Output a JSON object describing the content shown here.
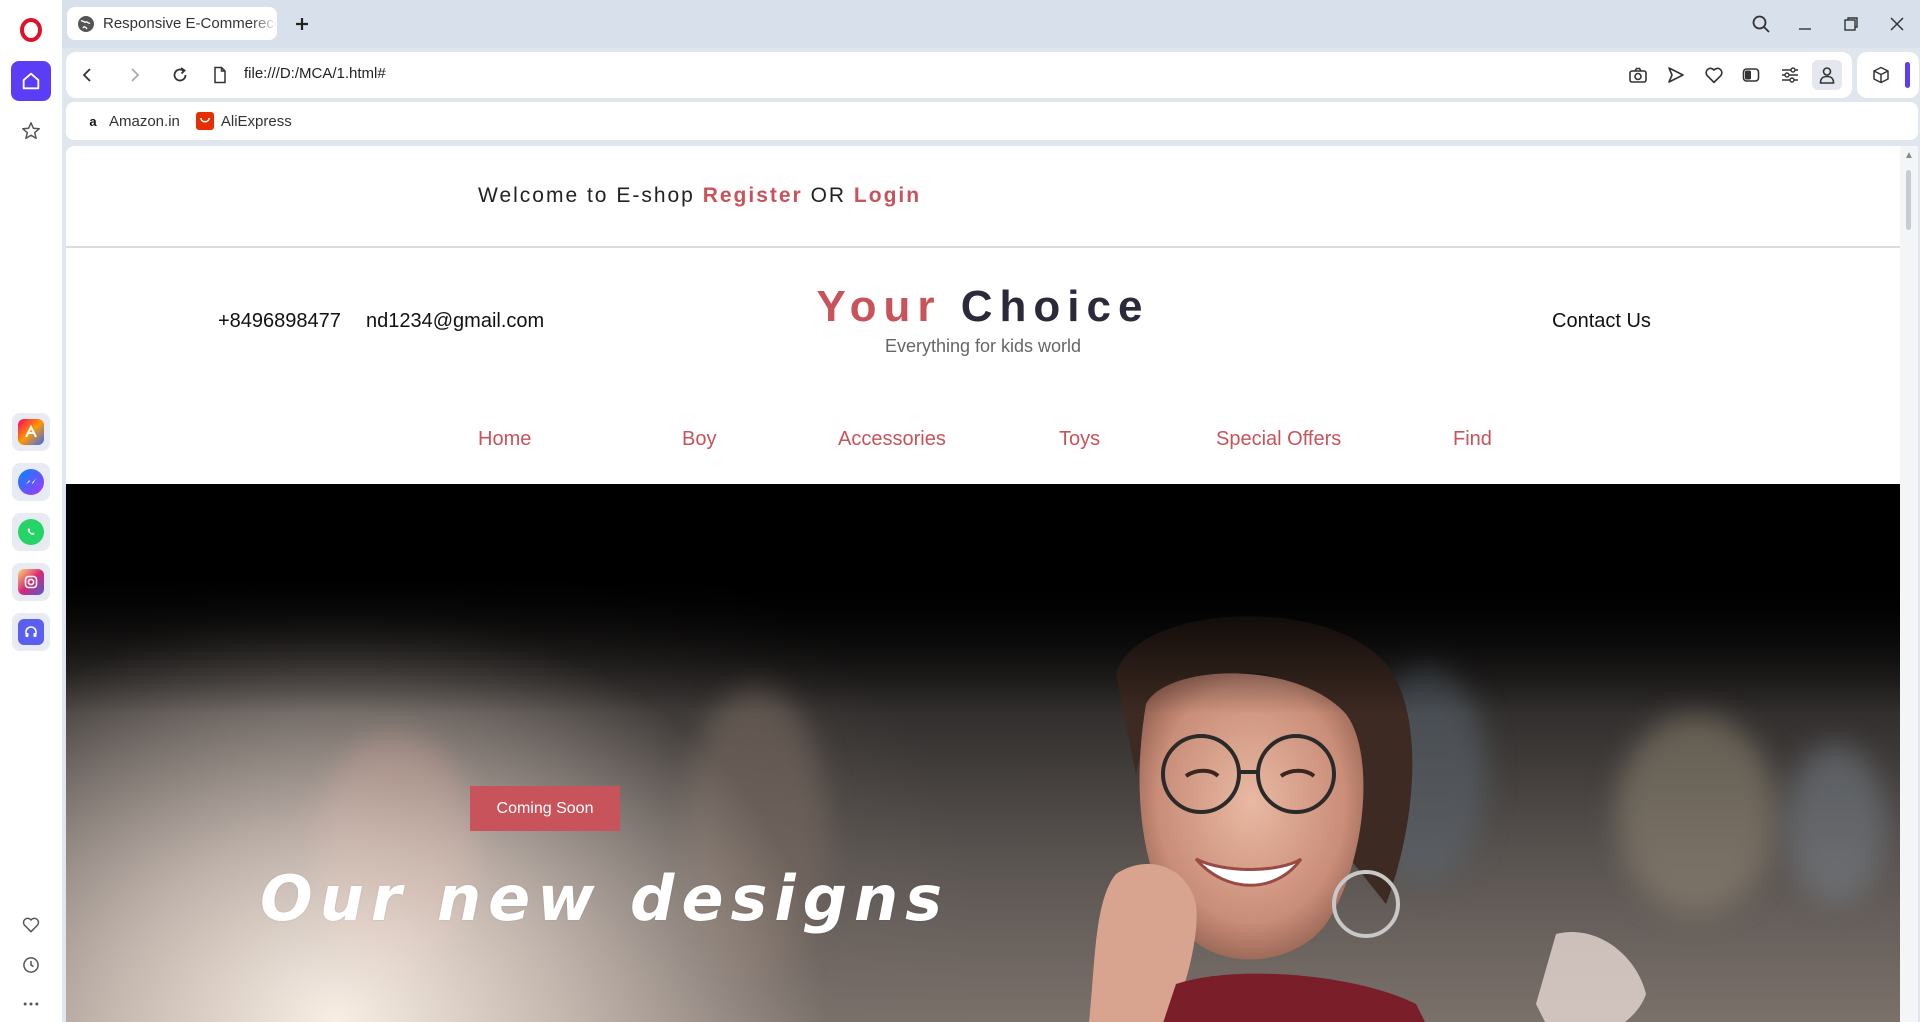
{
  "browser": {
    "tab_title": "Responsive E-Commerece",
    "url": "file:///D:/MCA/1.html#",
    "bookmarks": [
      {
        "label": "Amazon.in",
        "icon": "amazon-icon"
      },
      {
        "label": "AliExpress",
        "icon": "aliexpress-icon"
      }
    ],
    "accent_color": "#5b3df5"
  },
  "site": {
    "welcome_text": "Welcome to E-shop",
    "register_label": "Register",
    "or_text": "OR",
    "login_label": "Login",
    "phone": "+8496898477",
    "email": "nd1234@gmail.com",
    "brand_part1": "Your",
    "brand_part2": "Choice",
    "tagline": "Everything for kids world",
    "contact_label": "Contact Us",
    "menu": [
      {
        "label": "Home"
      },
      {
        "label": "Boy"
      },
      {
        "label": "Accessories"
      },
      {
        "label": "Toys"
      },
      {
        "label": "Special Offers"
      },
      {
        "label": "Find"
      }
    ],
    "accent_color": "#c9535a",
    "hero": {
      "badge_label": "Coming Soon",
      "title": "Our new designs"
    }
  }
}
